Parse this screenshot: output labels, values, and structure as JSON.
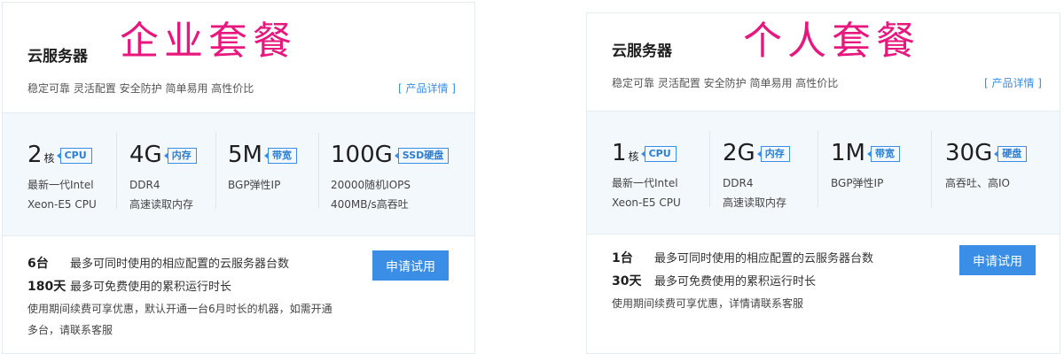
{
  "enterprise": {
    "title": "云服务器",
    "promo": "企业套餐",
    "tagline": "稳定可靠 灵活配置 安全防护 简单易用 高性价比",
    "details_link": "[ 产品详情 ]",
    "specs": [
      {
        "value": "2",
        "unit": "核",
        "badge": "CPU",
        "desc1": "最新一代Intel",
        "desc2": "Xeon-E5 CPU"
      },
      {
        "value": "4G",
        "unit": "",
        "badge": "内存",
        "desc1": "DDR4",
        "desc2": "高速读取内存"
      },
      {
        "value": "5M",
        "unit": "",
        "badge": "带宽",
        "desc1": "BGP弹性IP",
        "desc2": ""
      },
      {
        "value": "100G",
        "unit": "",
        "badge": "SSD硬盘",
        "desc1": "20000随机IOPS",
        "desc2": "400MB/s高吞吐"
      }
    ],
    "count_value": "6台",
    "count_desc": "最多可同时使用的相应配置的云服务器台数",
    "days_value": "180天",
    "days_desc": "最多可免费使用的累积运行时长",
    "note1": "使用期间续费可享优惠，默认开通一台6月时长的机器，如需开通",
    "note2": "多台，请联系客服",
    "apply_label": "申请试用"
  },
  "personal": {
    "title": "云服务器",
    "promo": "个人套餐",
    "tagline": "稳定可靠 灵活配置 安全防护 简单易用 高性价比",
    "details_link": "[ 产品详情 ]",
    "specs": [
      {
        "value": "1",
        "unit": "核",
        "badge": "CPU",
        "desc1": "最新一代Intel",
        "desc2": "Xeon-E5 CPU"
      },
      {
        "value": "2G",
        "unit": "",
        "badge": "内存",
        "desc1": "DDR4",
        "desc2": "高速读取内存"
      },
      {
        "value": "1M",
        "unit": "",
        "badge": "带宽",
        "desc1": "BGP弹性IP",
        "desc2": ""
      },
      {
        "value": "30G",
        "unit": "",
        "badge": "硬盘",
        "desc1": "高吞吐、高IO",
        "desc2": ""
      }
    ],
    "count_value": "1台",
    "count_desc": "最多可同时使用的相应配置的云服务器台数",
    "days_value": "30天",
    "days_desc": "最多可免费使用的累积运行时长",
    "note1": "使用期间续费可享优惠，详情请联系客服",
    "apply_label": "申请试用"
  },
  "colors": {
    "accent": "#3a8ee6",
    "promo": "#e8177e",
    "spec_bg": "#f3f8fd"
  }
}
